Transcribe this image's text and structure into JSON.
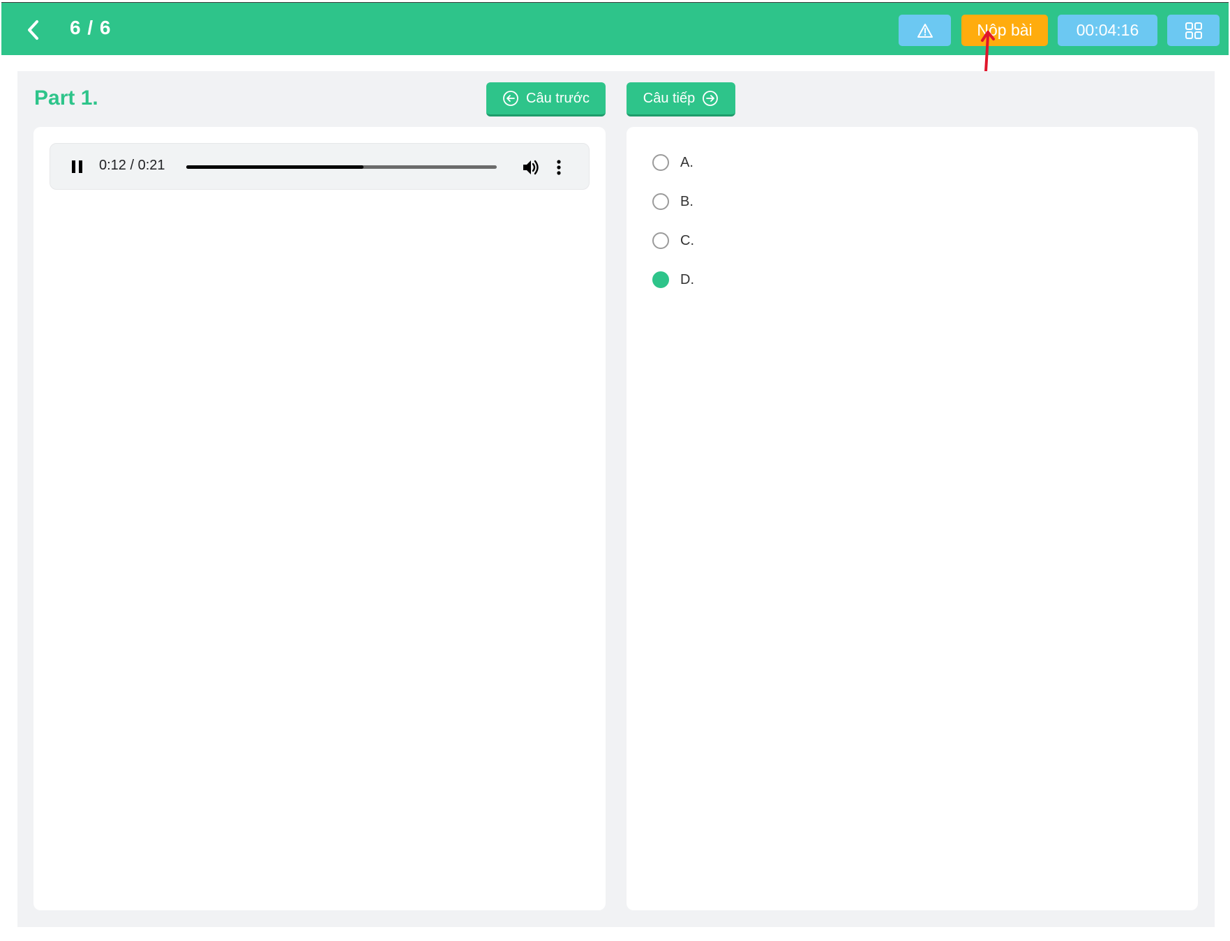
{
  "header": {
    "question_counter": "6 / 6",
    "back_icon": "chevron-left-icon",
    "report_icon": "warning-triangle-icon",
    "submit_label": "Nộp bài",
    "timer": "00:04:16",
    "grid_icon": "grid-view-icon",
    "colors": {
      "bar": "#2ec48a",
      "submit": "#ffac0e",
      "info": "#6cc8f2"
    }
  },
  "section": {
    "title": "Part 1.",
    "prev_label": "Câu trước",
    "next_label": "Câu tiếp"
  },
  "audio": {
    "time_display": "0:12 / 0:21",
    "progress": 0.571
  },
  "options": [
    {
      "label": "A.",
      "selected": false
    },
    {
      "label": "B.",
      "selected": false
    },
    {
      "label": "C.",
      "selected": false
    },
    {
      "label": "D.",
      "selected": true
    }
  ]
}
